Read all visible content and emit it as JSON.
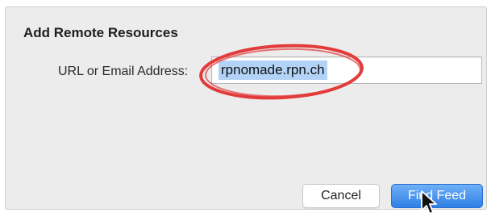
{
  "dialog": {
    "title": "Add Remote Resources",
    "url_label": "URL or Email Address:",
    "url_value": "rpnomade.rpn.ch"
  },
  "buttons": {
    "cancel_label": "Cancel",
    "find_feed_label": "Find Feed"
  },
  "colors": {
    "highlight_circle": "#e33b3b",
    "primary_button": "#3d8bf0",
    "selection": "#b2d3f7"
  },
  "icons": {
    "cursor": "arrow-pointer-icon"
  }
}
